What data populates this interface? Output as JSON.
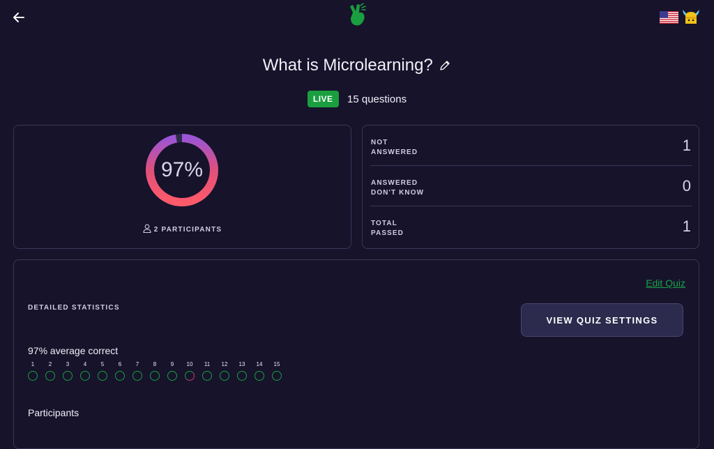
{
  "header": {
    "back_icon": "arrow-left-icon",
    "logo_icon": "hand-logo-icon",
    "flag_icon": "us-flag-icon",
    "mascot_icon": "viking-mascot-icon"
  },
  "quiz": {
    "title": "What is Microlearning?",
    "status": "LIVE",
    "status_color": "#1a9e3f",
    "question_count_text": "15 questions"
  },
  "score": {
    "percent_text": "97%",
    "percent": 97,
    "participants_text": "2 PARTICIPANTS"
  },
  "stats": [
    {
      "label_line1": "NOT",
      "label_line2": "ANSWERED",
      "value": "1"
    },
    {
      "label_line1": "ANSWERED",
      "label_line2": "DON'T KNOW",
      "value": "0"
    },
    {
      "label_line1": "TOTAL",
      "label_line2": "PASSED",
      "value": "1"
    }
  ],
  "detail": {
    "edit_link": "Edit Quiz",
    "heading": "DETAILED STATISTICS",
    "settings_button": "VIEW QUIZ SETTINGS",
    "average_text": "97% average correct",
    "questions": [
      {
        "num": "1",
        "state": "correct"
      },
      {
        "num": "2",
        "state": "correct"
      },
      {
        "num": "3",
        "state": "correct"
      },
      {
        "num": "4",
        "state": "correct"
      },
      {
        "num": "5",
        "state": "correct"
      },
      {
        "num": "6",
        "state": "correct"
      },
      {
        "num": "7",
        "state": "correct"
      },
      {
        "num": "8",
        "state": "correct"
      },
      {
        "num": "9",
        "state": "correct"
      },
      {
        "num": "10",
        "state": "mixed"
      },
      {
        "num": "11",
        "state": "correct"
      },
      {
        "num": "12",
        "state": "correct"
      },
      {
        "num": "13",
        "state": "correct"
      },
      {
        "num": "14",
        "state": "correct"
      },
      {
        "num": "15",
        "state": "correct"
      }
    ],
    "participants_heading": "Participants"
  }
}
